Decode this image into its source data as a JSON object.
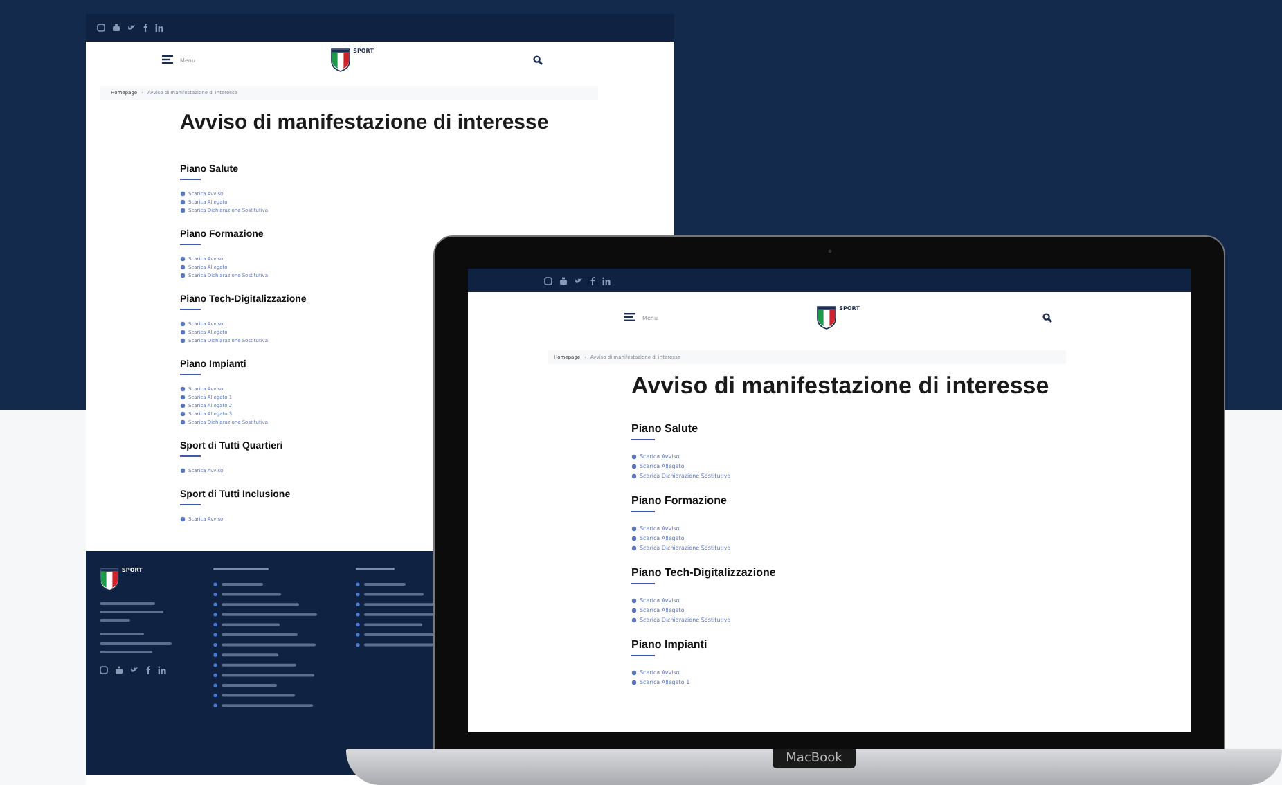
{
  "back_page": {
    "menu_label": "Menu",
    "logo_text": "SPORT",
    "breadcrumb_separator": "›",
    "breadcrumb": [
      "Homepage",
      "Avviso di manifestazione di interesse"
    ],
    "title": "Avviso di manifestazione di interesse",
    "sections": [
      {
        "heading": "Piano Salute",
        "links": [
          "Scarica Avviso",
          "Scarica Allegato",
          "Scarica Dichiarazione Sostitutiva"
        ]
      },
      {
        "heading": "Piano Formazione",
        "links": [
          "Scarica Avviso",
          "Scarica Allegato",
          "Scarica Dichiarazione Sostitutiva"
        ]
      },
      {
        "heading": "Piano Tech-Digitalizzazione",
        "links": [
          "Scarica Avviso",
          "Scarica Allegato",
          "Scarica Dichiarazione Sostitutiva"
        ]
      },
      {
        "heading": "Piano Impianti",
        "links": [
          "Scarica Avviso",
          "Scarica Allegato 1",
          "Scarica Allegato 2",
          "Scarica Allegato 3",
          "Scarica Dichiarazione Sostitutiva"
        ]
      },
      {
        "heading": "Sport di Tutti Quartieri",
        "links": [
          "Scarica Avviso"
        ]
      },
      {
        "heading": "Sport di Tutti Inclusione",
        "links": [
          "Scarica Avviso"
        ]
      }
    ],
    "footer": {
      "logo_text": "SPORT"
    }
  },
  "laptop_page": {
    "menu_label": "Menu",
    "logo_text": "SPORT",
    "breadcrumb_separator": "›",
    "breadcrumb": [
      "Homepage",
      "Avviso di manifestazione di interesse"
    ],
    "title": "Avviso di manifestazione di interesse",
    "sections": [
      {
        "heading": "Piano Salute",
        "links": [
          "Scarica Avviso",
          "Scarica Allegato",
          "Scarica Dichiarazione Sostitutiva"
        ]
      },
      {
        "heading": "Piano Formazione",
        "links": [
          "Scarica Avviso",
          "Scarica Allegato",
          "Scarica Dichiarazione Sostitutiva"
        ]
      },
      {
        "heading": "Piano Tech-Digitalizzazione",
        "links": [
          "Scarica Avviso",
          "Scarica Allegato",
          "Scarica Dichiarazione Sostitutiva"
        ]
      },
      {
        "heading": "Piano Impianti",
        "links": [
          "Scarica Avviso",
          "Scarica Allegato 1"
        ]
      }
    ]
  },
  "laptop_brand": "MacBook"
}
